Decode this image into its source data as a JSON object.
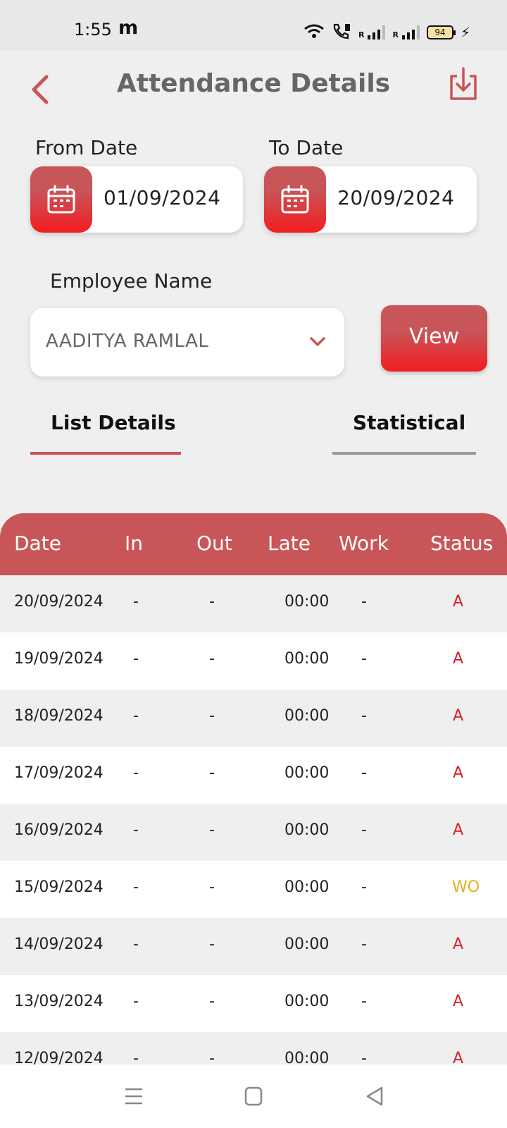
{
  "status_bar": {
    "time": "1:55",
    "app_badge": "m",
    "battery": "94",
    "sim1_label": "R",
    "sim2_label": "R"
  },
  "header": {
    "title": "Attendance Details",
    "back_icon": "chevron-left-icon",
    "download_icon": "download-icon"
  },
  "filters": {
    "from_label": "From Date",
    "from_value": "01/09/2024",
    "to_label": "To Date",
    "to_value": "20/09/2024",
    "employee_label": "Employee Name",
    "employee_value": "AADITYA RAMLAL",
    "view_label": "View"
  },
  "tabs": [
    {
      "label": "List Details",
      "active": true
    },
    {
      "label": "Statistical",
      "active": false
    }
  ],
  "table": {
    "headers": [
      "Date",
      "In",
      "Out",
      "Late",
      "Work",
      "Status"
    ],
    "rows": [
      {
        "date": "20/09/2024",
        "in": "-",
        "out": "-",
        "late": "00:00",
        "work": "-",
        "status": "A"
      },
      {
        "date": "19/09/2024",
        "in": "-",
        "out": "-",
        "late": "00:00",
        "work": "-",
        "status": "A"
      },
      {
        "date": "18/09/2024",
        "in": "-",
        "out": "-",
        "late": "00:00",
        "work": "-",
        "status": "A"
      },
      {
        "date": "17/09/2024",
        "in": "-",
        "out": "-",
        "late": "00:00",
        "work": "-",
        "status": "A"
      },
      {
        "date": "16/09/2024",
        "in": "-",
        "out": "-",
        "late": "00:00",
        "work": "-",
        "status": "A"
      },
      {
        "date": "15/09/2024",
        "in": "-",
        "out": "-",
        "late": "00:00",
        "work": "-",
        "status": "WO"
      },
      {
        "date": "14/09/2024",
        "in": "-",
        "out": "-",
        "late": "00:00",
        "work": "-",
        "status": "A"
      },
      {
        "date": "13/09/2024",
        "in": "-",
        "out": "-",
        "late": "00:00",
        "work": "-",
        "status": "A"
      },
      {
        "date": "12/09/2024",
        "in": "-",
        "out": "-",
        "late": "00:00",
        "work": "-",
        "status": "A"
      }
    ]
  },
  "colors": {
    "accent": "#c85558",
    "accent_bright": "#f21d20",
    "absent": "#d92328",
    "week_off": "#e0b21c",
    "tab_inactive": "#9a9a9a"
  },
  "nav": {
    "menu_icon": "menu-icon",
    "home_icon": "home-square-icon",
    "back_icon": "back-triangle-icon"
  }
}
